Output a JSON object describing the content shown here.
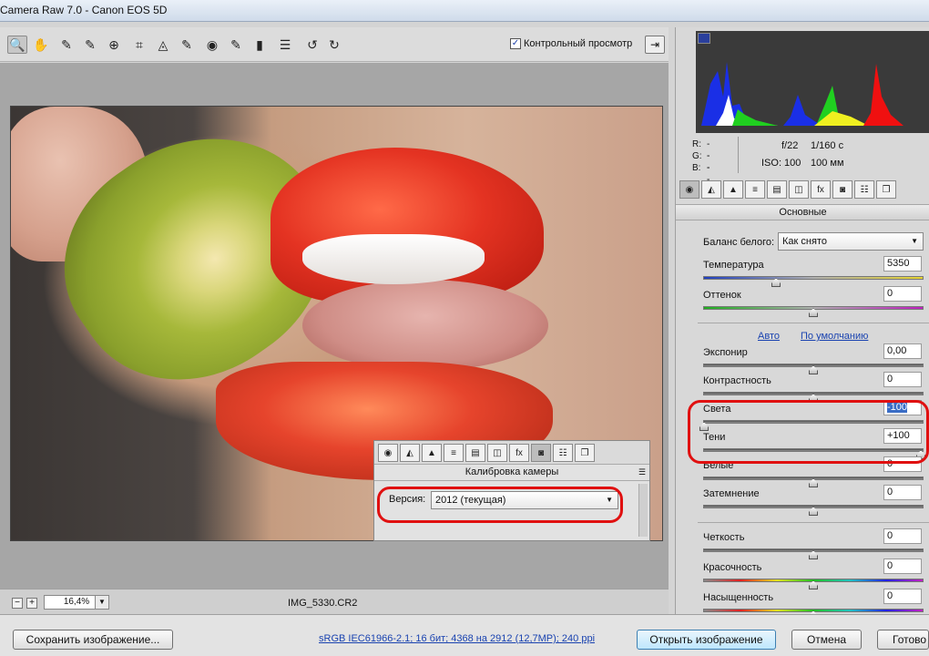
{
  "window": {
    "title": "Camera Raw 7.0  -  Canon EOS 5D"
  },
  "toolbar": {
    "tools": [
      {
        "icon": "zoom-icon",
        "glyph": "🔍"
      },
      {
        "icon": "hand-icon",
        "glyph": "✋"
      },
      {
        "icon": "eyedropper-icon",
        "glyph": "⟋"
      },
      {
        "icon": "color-sampler-icon",
        "glyph": "⟋"
      },
      {
        "icon": "target-adjustment-icon",
        "glyph": "⊕"
      },
      {
        "icon": "crop-icon",
        "glyph": "⌗"
      },
      {
        "icon": "straighten-icon",
        "glyph": "◬"
      },
      {
        "icon": "spot-removal-icon",
        "glyph": "⟋"
      },
      {
        "icon": "red-eye-icon",
        "glyph": "◉"
      },
      {
        "icon": "adjustment-brush-icon",
        "glyph": "⟋"
      },
      {
        "icon": "graduated-filter-icon",
        "glyph": "▮"
      },
      {
        "icon": "preferences-icon",
        "glyph": "☰"
      },
      {
        "icon": "rotate-left-icon",
        "glyph": "↺"
      },
      {
        "icon": "rotate-right-icon",
        "glyph": "↻"
      }
    ],
    "preview_label": "Контрольный просмотр",
    "preview_checked": true
  },
  "canvas": {
    "filename": "IMG_5330.CR2",
    "zoom": "16,4%",
    "calibration_popup": {
      "title": "Калибровка камеры",
      "version_label": "Версия:",
      "version_value": "2012 (текущая)"
    }
  },
  "panel": {
    "readout": {
      "r": "R:",
      "g": "G:",
      "b": "B:",
      "r_val": "---",
      "g_val": "---",
      "b_val": "---"
    },
    "camera": {
      "aperture": "f/22",
      "shutter": "1/160 с",
      "iso": "ISO: 100",
      "focal": "100 мм"
    },
    "tabs": [
      "◉",
      "◭",
      "▲",
      "≡",
      "▤",
      "◫",
      "fx",
      "◙",
      "☷",
      "❐"
    ],
    "section_title": "Основные",
    "white_balance": {
      "label": "Баланс белого:",
      "value": "Как снято"
    },
    "auto_link": "Авто",
    "default_link": "По умолчанию",
    "sliders": {
      "temperature": {
        "label": "Температура",
        "value": "5350"
      },
      "tint": {
        "label": "Оттенок",
        "value": "0"
      },
      "exposure": {
        "label": "Экспонир",
        "value": "0,00"
      },
      "contrast": {
        "label": "Контрастность",
        "value": "0"
      },
      "highlights": {
        "label": "Света",
        "value": "-100"
      },
      "shadows": {
        "label": "Тени",
        "value": "+100"
      },
      "whites": {
        "label": "Белые",
        "value": "0"
      },
      "blacks": {
        "label": "Затемнение",
        "value": "0"
      },
      "clarity": {
        "label": "Четкость",
        "value": "0"
      },
      "vibrance": {
        "label": "Красочность",
        "value": "0"
      },
      "saturation": {
        "label": "Насыщенность",
        "value": "0"
      }
    }
  },
  "bottom": {
    "save_button": "Сохранить изображение...",
    "workflow_link": "sRGB IEC61966-2.1; 16 бит; 4368 на 2912 (12,7МР); 240 ppi",
    "open_button": "Открыть изображение",
    "cancel_button": "Отмена",
    "done_button": "Готово"
  },
  "colors": {
    "accent_red": "#e01010",
    "link_blue": "#1a43b0",
    "selection": "#3a6dc6"
  }
}
